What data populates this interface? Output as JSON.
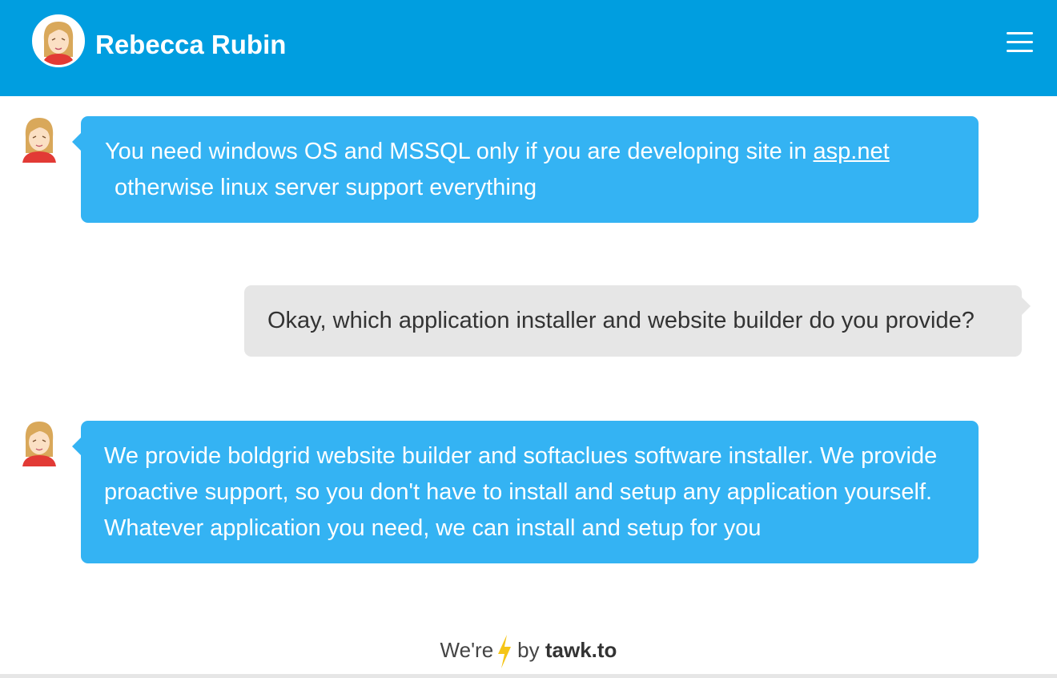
{
  "header": {
    "agent_name": "Rebecca Rubin",
    "menu_icon": "hamburger-menu-icon"
  },
  "colors": {
    "header_bg": "#009ee0",
    "agent_bubble": "#34b3f3",
    "visitor_bubble": "#e6e6e6"
  },
  "messages": [
    {
      "sender": "agent",
      "text_before_link": "You need windows OS and MSSQL only if you are developing site in ",
      "link_text": "asp.net",
      "text_after_link": " otherwise linux server support everything"
    },
    {
      "sender": "visitor",
      "text": "Okay, which application installer and website builder do you provide?"
    },
    {
      "sender": "agent",
      "text": "We provide boldgrid website builder and softaclues software installer. We provide proactive support, so you don't have to install and setup any application yourself. Whatever application you need, we can install and setup for you"
    }
  ],
  "footer": {
    "prefix": "We're",
    "middle": "by",
    "brand": "tawk.to",
    "icon": "lightning-bolt-icon"
  }
}
